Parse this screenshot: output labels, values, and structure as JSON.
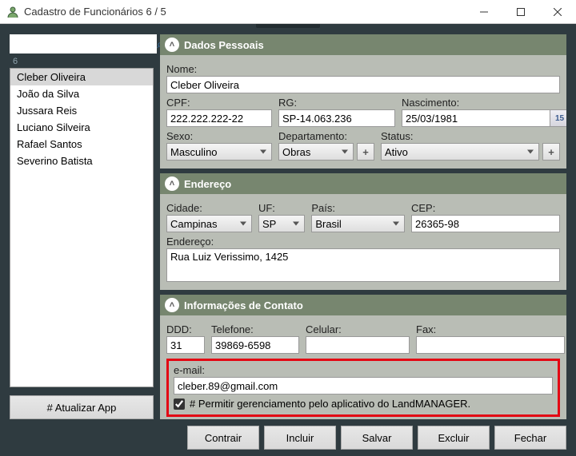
{
  "window": {
    "title": "Cadastro de Funcionários 6 / 5"
  },
  "sidebar": {
    "search_value": "",
    "count": "6",
    "items": [
      {
        "label": "Cleber Oliveira"
      },
      {
        "label": "João da Silva"
      },
      {
        "label": "Jussara Reis"
      },
      {
        "label": "Luciano Silveira"
      },
      {
        "label": "Rafael Santos"
      },
      {
        "label": "Severino Batista"
      }
    ],
    "update_btn": "# Atualizar App"
  },
  "sections": {
    "pessoais": {
      "title": "Dados Pessoais",
      "nome_lbl": "Nome:",
      "nome": "Cleber Oliveira",
      "cpf_lbl": "CPF:",
      "cpf": "222.222.222-22",
      "rg_lbl": "RG:",
      "rg": "SP-14.063.236",
      "nasc_lbl": "Nascimento:",
      "nasc": "25/03/1981",
      "cal_day": "15",
      "sexo_lbl": "Sexo:",
      "sexo": "Masculino",
      "dept_lbl": "Departamento:",
      "dept": "Obras",
      "status_lbl": "Status:",
      "status": "Ativo"
    },
    "endereco": {
      "title": "Endereço",
      "cidade_lbl": "Cidade:",
      "cidade": "Campinas",
      "uf_lbl": "UF:",
      "uf": "SP",
      "pais_lbl": "País:",
      "pais": "Brasil",
      "cep_lbl": "CEP:",
      "cep": "26365-98",
      "end_lbl": "Endereço:",
      "end": "Rua Luiz Verissimo, 1425"
    },
    "contato": {
      "title": "Informações de Contato",
      "ddd_lbl": "DDD:",
      "ddd": "31",
      "tel_lbl": "Telefone:",
      "tel": "39869-6598",
      "cel_lbl": "Celular:",
      "cel": "",
      "fax_lbl": "Fax:",
      "fax": "",
      "email_lbl": "e-mail:",
      "email": "cleber.89@gmail.com",
      "perm_label": "# Permitir gerenciamento pelo aplicativo do LandMANAGER."
    }
  },
  "footer": {
    "contrair": "Contrair",
    "incluir": "Incluir",
    "salvar": "Salvar",
    "excluir": "Excluir",
    "fechar": "Fechar"
  }
}
